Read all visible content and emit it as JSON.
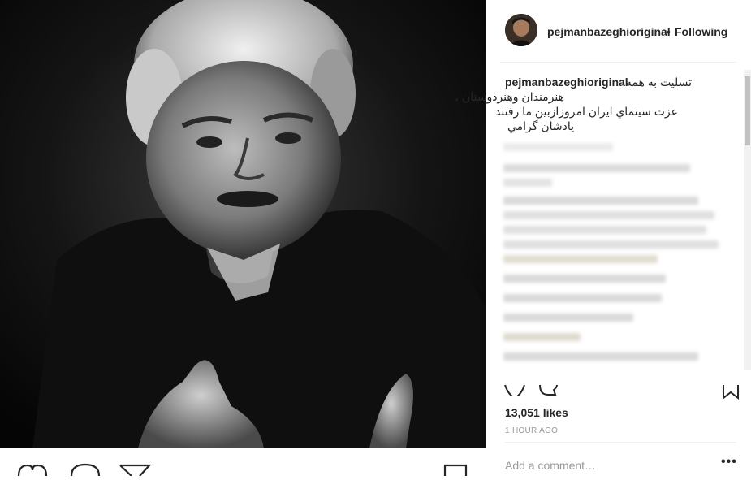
{
  "post": {
    "username": "pejmanbazeghioriginal",
    "separator": "•",
    "follow_status": "Following",
    "caption_user": "pejmanbazeghioriginal",
    "caption_lines": [
      "تسلیت به همه",
      "هنرمندان وهنردوستان ،",
      "عزت سينماي ايران امروزازبين ما رفتند",
      "يادشان گرامي"
    ],
    "likes": "13,051 likes",
    "time": "1 HOUR AGO",
    "add_comment_placeholder": "Add a comment…",
    "more_options": "•••"
  },
  "icons": {
    "like": "heart-icon",
    "comment": "comment-icon",
    "share": "share-icon",
    "save": "bookmark-icon"
  },
  "colors": {
    "text": "#262626",
    "muted": "#999999",
    "divider": "#efefef"
  }
}
